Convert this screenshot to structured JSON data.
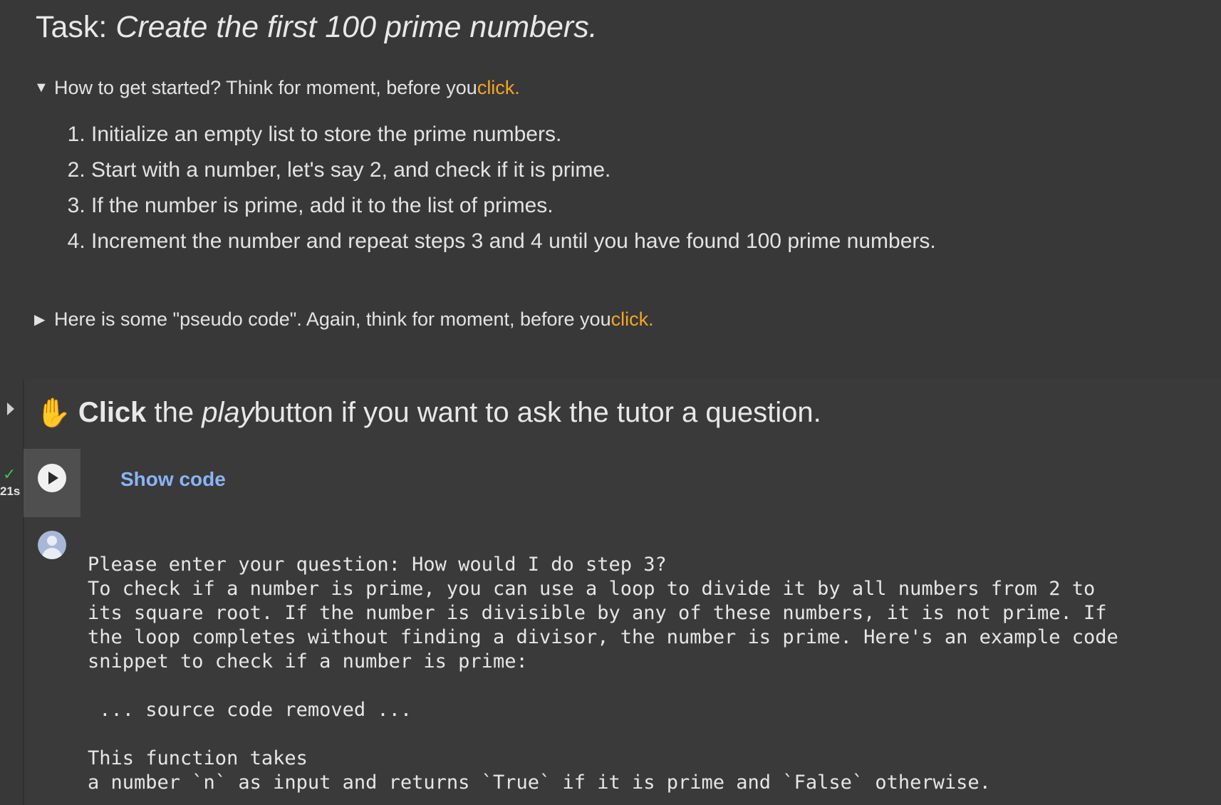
{
  "task": {
    "prefix": "Task: ",
    "title": "Create the first 100 prime numbers."
  },
  "hint_1": {
    "summary": "How to get started? Think for moment, before you ",
    "link": "click.",
    "steps": [
      "Initialize an empty list to store the prime numbers.",
      "Start with a number, let's say 2, and check if it is prime.",
      "If the number is prime, add it to the list of primes.",
      "Increment the number and repeat steps 3 and 4 until you have found 100 prime numbers."
    ]
  },
  "hint_2": {
    "summary": "Here is some \"pseudo code\". Again, think for moment, before you ",
    "link": "click."
  },
  "cell": {
    "heading_bold": "Click",
    "heading_mid": " the ",
    "heading_italic": "play",
    "heading_end": " button if you want to ask the tutor a question.",
    "exec_time": "21s",
    "show_code": "Show code",
    "output": "Please enter your question: How would I do step 3?\nTo check if a number is prime, you can use a loop to divide it by all numbers from 2 to\nits square root. If the number is divisible by any of these numbers, it is not prime. If\nthe loop completes without finding a divisor, the number is prime. Here's an example code\nsnippet to check if a number is prime:\n\n ... source code removed ...\n\nThis function takes\na number `n` as input and returns `True` if it is prime and `False` otherwise."
  },
  "icons": {
    "hand": "raised-hand-icon",
    "play": "play-icon",
    "check": "checkmark-icon",
    "avatar": "user-avatar-icon"
  },
  "colors": {
    "background": "#383838",
    "link_orange": "#f5a623",
    "show_code_blue": "#8ab4f8",
    "check_green": "#3fbf5a"
  }
}
